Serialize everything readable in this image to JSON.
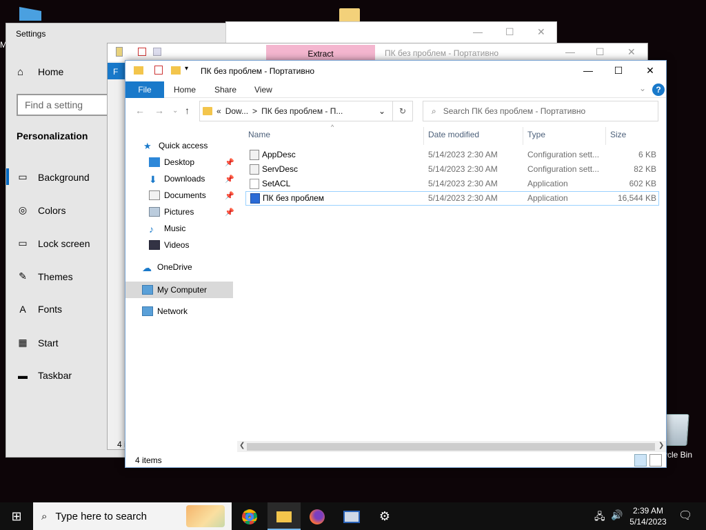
{
  "desktop": {
    "recycle_bin_label": "ycle Bin",
    "partial_M": "M"
  },
  "settings": {
    "title": "Settings",
    "home": "Home",
    "search_placeholder": "Find a setting",
    "category": "Personalization",
    "items": [
      {
        "label": "Background",
        "icon": "image-icon"
      },
      {
        "label": "Colors",
        "icon": "palette-icon"
      },
      {
        "label": "Lock screen",
        "icon": "lock-screen-icon"
      },
      {
        "label": "Themes",
        "icon": "brush-icon"
      },
      {
        "label": "Fonts",
        "icon": "font-icon"
      },
      {
        "label": "Start",
        "icon": "start-grid-icon"
      },
      {
        "label": "Taskbar",
        "icon": "taskbar-icon"
      }
    ]
  },
  "back_window": {
    "extract_tab": "Extract",
    "title": "ПК без проблем - Портативно",
    "partial_file_tab": "F",
    "partial_status": "4 i"
  },
  "explorer": {
    "title": "ПК без проблем - Портативно",
    "tabs": {
      "file": "File",
      "home": "Home",
      "share": "Share",
      "view": "View"
    },
    "address": {
      "prefix": "«",
      "seg1": "Dow...",
      "sep": ">",
      "seg2": "ПК без проблем - П..."
    },
    "search_placeholder": "Search ПК без проблем - Портативно",
    "nav": {
      "quick_access": "Quick access",
      "desktop": "Desktop",
      "downloads": "Downloads",
      "documents": "Documents",
      "pictures": "Pictures",
      "music": "Music",
      "videos": "Videos",
      "onedrive": "OneDrive",
      "my_computer": "My Computer",
      "network": "Network"
    },
    "columns": {
      "name": "Name",
      "date": "Date modified",
      "type": "Type",
      "size": "Size"
    },
    "files": [
      {
        "name": "AppDesc",
        "date": "5/14/2023 2:30 AM",
        "type": "Configuration sett...",
        "size": "6 KB"
      },
      {
        "name": "ServDesc",
        "date": "5/14/2023 2:30 AM",
        "type": "Configuration sett...",
        "size": "82 KB"
      },
      {
        "name": "SetACL",
        "date": "5/14/2023 2:30 AM",
        "type": "Application",
        "size": "602 KB"
      },
      {
        "name": "ПК без проблем",
        "date": "5/14/2023 2:30 AM",
        "type": "Application",
        "size": "16,544 KB"
      }
    ],
    "status": "4 items"
  },
  "taskbar": {
    "search_placeholder": "Type here to search",
    "time": "2:39 AM",
    "date": "5/14/2023"
  }
}
